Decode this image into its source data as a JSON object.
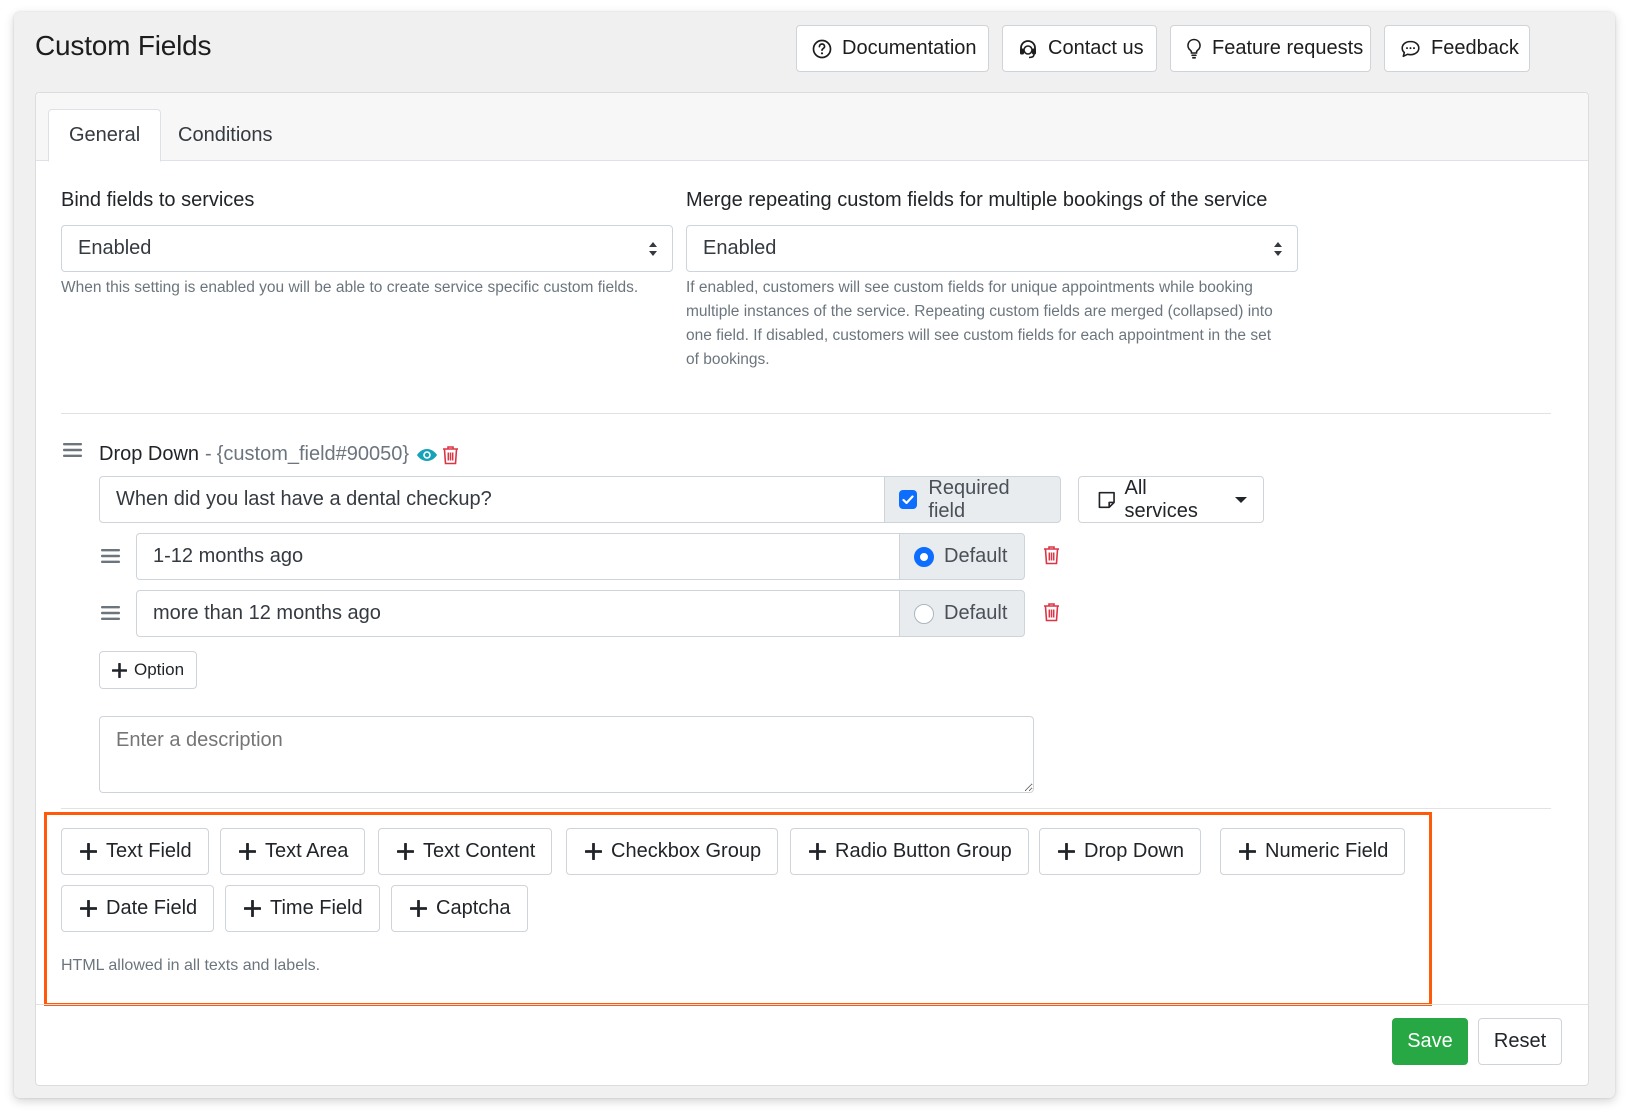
{
  "page": {
    "title": "Custom Fields"
  },
  "header_buttons": [
    {
      "label": "Documentation",
      "icon": "question-circle-icon"
    },
    {
      "label": "Contact us",
      "icon": "headset-icon"
    },
    {
      "label": "Feature requests",
      "icon": "lightbulb-icon"
    },
    {
      "label": "Feedback",
      "icon": "chat-bubble-icon"
    }
  ],
  "tabs": [
    {
      "label": "General",
      "active": true
    },
    {
      "label": "Conditions",
      "active": false
    }
  ],
  "settings": {
    "bind_fields": {
      "label": "Bind fields to services",
      "value": "Enabled",
      "help": "When this setting is enabled you will be able to create service specific custom fields."
    },
    "merge_fields": {
      "label": "Merge repeating custom fields for multiple bookings of the service",
      "value": "Enabled",
      "help": "If enabled, customers will see custom fields for unique appointments while booking multiple instances of the service. Repeating custom fields are merged (collapsed) into one field. If disabled, customers will see custom fields for each appointment in the set of bookings."
    }
  },
  "custom_field": {
    "type": "Drop Down",
    "separator": "-",
    "code": "{custom_field#90050}",
    "question": "When did you last have a dental checkup?",
    "required_label": "Required field",
    "required": true,
    "services_label": "All services",
    "options": [
      {
        "value": "1-12 months ago",
        "default_label": "Default",
        "is_default": true
      },
      {
        "value": "more than 12 months ago",
        "default_label": "Default",
        "is_default": false
      }
    ],
    "add_option_label": "Option",
    "description_placeholder": "Enter a description"
  },
  "add_field_buttons": [
    "Text Field",
    "Text Area",
    "Text Content",
    "Checkbox Group",
    "Radio Button Group",
    "Drop Down",
    "Numeric Field",
    "Date Field",
    "Time Field",
    "Captcha"
  ],
  "html_note": "HTML allowed in all texts and labels.",
  "footer": {
    "save_label": "Save",
    "reset_label": "Reset"
  },
  "colors": {
    "primary": "#0d6efd",
    "success": "#28a745",
    "danger": "#dc3545",
    "info": "#17a2b8",
    "highlight": "#ff5a0a"
  }
}
